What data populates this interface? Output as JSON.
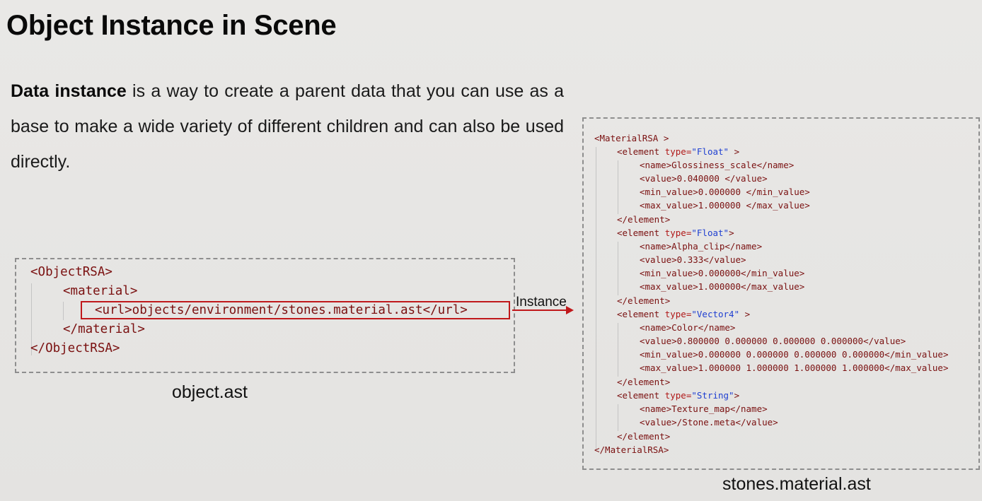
{
  "slide": {
    "title": "Object Instance in Scene",
    "description": {
      "bold": "Data instance",
      "rest": " is a way to create a parent data that you can use as a base to make a wide variety of different children and can also be used directly."
    },
    "arrow_label": "Instance",
    "captions": {
      "object_file": "object.ast",
      "material_file": "stones.material.ast"
    }
  },
  "object_ast": {
    "lines": [
      "<ObjectRSA>",
      "<material>",
      "<url>objects/environment/stones.material.ast</url>",
      "</material>",
      "</ObjectRSA>"
    ]
  },
  "material_ast": {
    "root_open": "<MaterialRSA >",
    "root_close": "</MaterialRSA>",
    "element_open_prefix": "<element ",
    "type_attr": "type=",
    "element_close": "</element>",
    "elements": [
      {
        "type_value": "\"Float\"",
        "open_suffix": " >",
        "children": [
          "<name>Glossiness_scale</name>",
          "<value>0.040000 </value>",
          "<min_value>0.000000 </min_value>",
          "<max_value>1.000000 </max_value>"
        ]
      },
      {
        "type_value": "\"Float\"",
        "open_suffix": ">",
        "children": [
          "<name>Alpha_clip</name>",
          "<value>0.333</value>",
          "<min_value>0.000000</min_value>",
          "<max_value>1.000000</max_value>"
        ]
      },
      {
        "type_value": "\"Vector4\"",
        "open_suffix": " >",
        "children": [
          "<name>Color</name>",
          "<value>0.800000 0.000000 0.000000 0.000000</value>",
          "<min_value>0.000000 0.000000 0.000000 0.000000</min_value>",
          "<max_value>1.000000 1.000000 1.000000 1.000000</max_value>"
        ]
      },
      {
        "type_value": "\"String\"",
        "open_suffix": ">",
        "children": [
          "<name>Texture_map</name>",
          "<value>/Stone.meta</value>"
        ]
      }
    ]
  },
  "colors": {
    "highlight_red": "#c0181b",
    "tag_color": "#7a1010",
    "string_blue": "#1f3fd1",
    "dashed_border": "#8e8e8e"
  }
}
